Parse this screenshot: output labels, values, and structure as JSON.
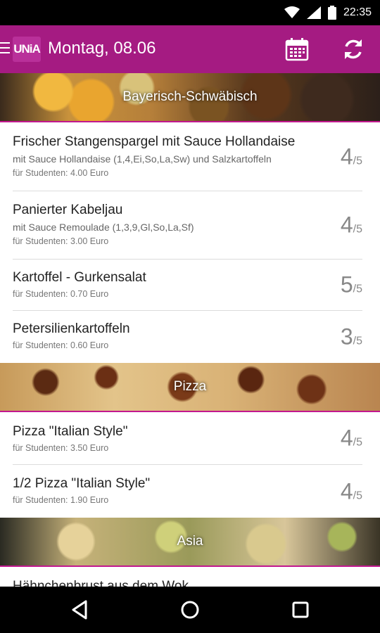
{
  "status": {
    "time": "22:35"
  },
  "appbar": {
    "logo_text": "UNiA",
    "title": "Montag, 08.06",
    "icons": [
      "menu-icon",
      "calendar-icon",
      "refresh-icon"
    ]
  },
  "sections": [
    {
      "title": "Bayerisch-Schwäbisch",
      "items": [
        {
          "name": "Frischer Stangenspargel  mit Sauce Hollandaise",
          "desc": "mit Sauce Hollandaise (1,4,Ei,So,La,Sw) und Salzkartoffeln",
          "price": "für Studenten: 4.00 Euro",
          "rating": "4",
          "rating_max": "/5"
        },
        {
          "name": "Panierter Kabeljau",
          "desc": "mit Sauce Remoulade (1,3,9,Gl,So,La,Sf)",
          "price": "für Studenten: 3.00 Euro",
          "rating": "4",
          "rating_max": "/5"
        },
        {
          "name": "Kartoffel - Gurkensalat",
          "desc": "",
          "price": "für Studenten: 0.70 Euro",
          "rating": "5",
          "rating_max": "/5"
        },
        {
          "name": "Petersilienkartoffeln",
          "desc": "",
          "price": "für Studenten: 0.60 Euro",
          "rating": "3",
          "rating_max": "/5"
        }
      ]
    },
    {
      "title": "Pizza",
      "items": [
        {
          "name": "Pizza \"Italian Style\"",
          "desc": "",
          "price": "für Studenten: 3.50 Euro",
          "rating": "4",
          "rating_max": "/5"
        },
        {
          "name": "1/2 Pizza \"Italian Style\"",
          "desc": "",
          "price": "für Studenten: 1.90 Euro",
          "rating": "4",
          "rating_max": "/5"
        }
      ]
    },
    {
      "title": "Asia",
      "items": [
        {
          "name": "Hähnchenbrust aus dem Wok",
          "desc": "",
          "price": "",
          "rating": "",
          "rating_max": ""
        }
      ]
    }
  ],
  "colors": {
    "primary": "#a51b82",
    "accent_line": "#c2188f"
  }
}
